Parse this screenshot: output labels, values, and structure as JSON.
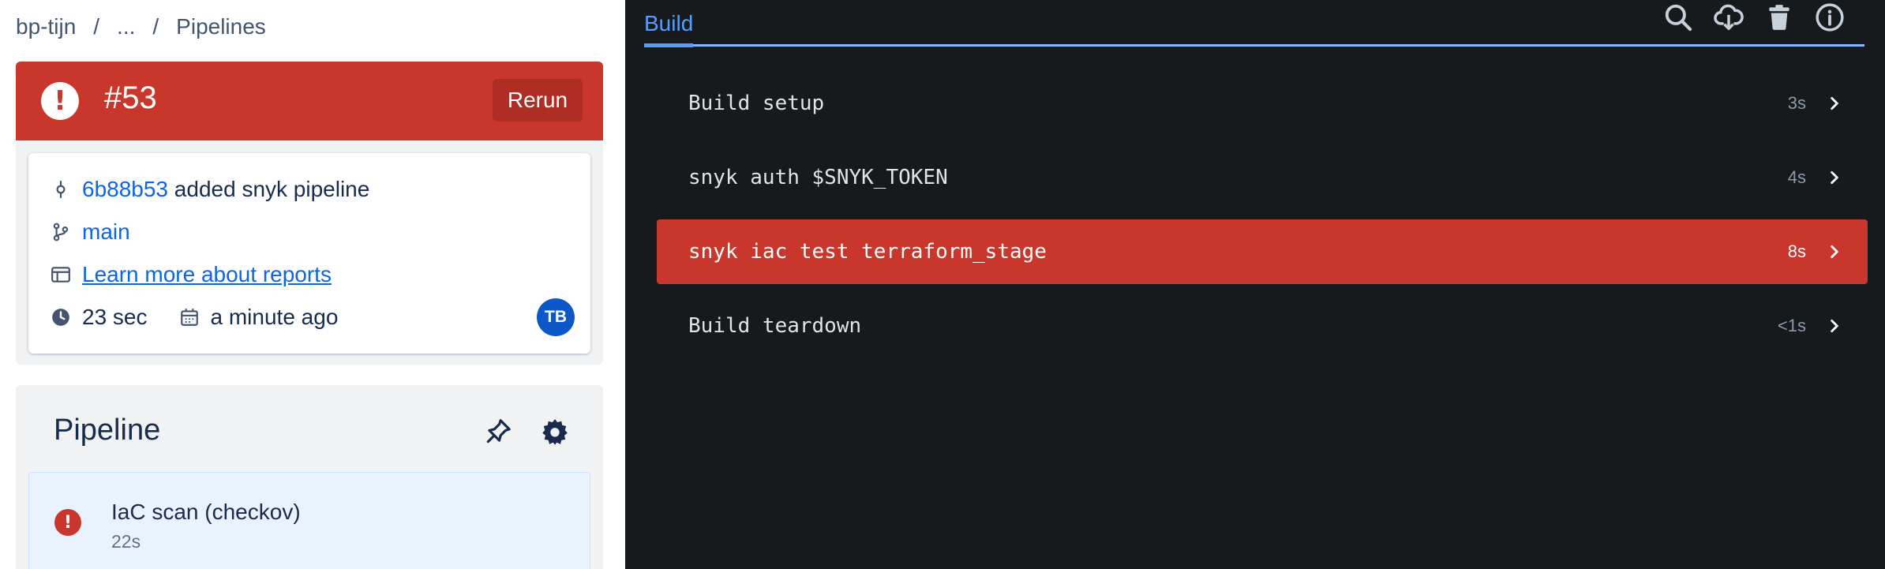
{
  "breadcrumb": {
    "items": [
      "bp-tijn",
      "...",
      "Pipelines"
    ],
    "separator": "/"
  },
  "build": {
    "status": "failed",
    "status_color": "#c9372c",
    "status_icon": "error-icon",
    "number": "#53",
    "rerun_label": "Rerun"
  },
  "summary": {
    "commit_hash": "6b88b53",
    "commit_message": "added snyk pipeline",
    "branch": "main",
    "reports_link": "Learn more about reports",
    "duration": "23 sec",
    "started": "a minute ago",
    "avatar_initials": "TB",
    "avatar_color": "#0c58c9"
  },
  "pipeline": {
    "title": "Pipeline",
    "steps": [
      {
        "name": "IaC scan (checkov)",
        "duration": "22s",
        "status": "failed"
      }
    ]
  },
  "log_panel": {
    "tab_label": "Build",
    "toolbar_icons": [
      "search-icon",
      "download-icon",
      "trash-icon",
      "info-icon"
    ],
    "commands": [
      {
        "label": "Build setup",
        "duration": "3s",
        "status": "passed"
      },
      {
        "label": "snyk auth $SNYK_TOKEN",
        "duration": "4s",
        "status": "passed"
      },
      {
        "label": "snyk iac test terraform_stage",
        "duration": "8s",
        "status": "failed"
      },
      {
        "label": "Build teardown",
        "duration": "<1s",
        "status": "passed"
      }
    ]
  }
}
